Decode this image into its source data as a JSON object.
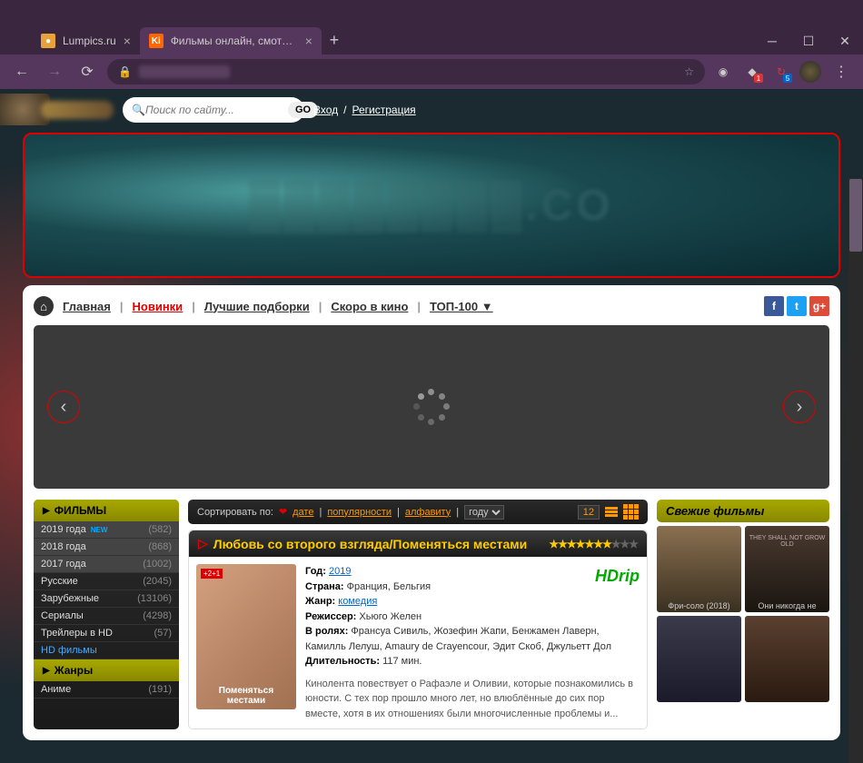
{
  "browser": {
    "tab1": "Lumpics.ru",
    "tab2": "Фильмы онлайн, смотреть бесп"
  },
  "header": {
    "search_placeholder": "Поиск по сайту...",
    "go": "GO",
    "login": "Вход",
    "register": "Регистрация"
  },
  "banner_suffix": ".CO",
  "nav": {
    "home": "Главная",
    "new": "Новинки",
    "best": "Лучшие подборки",
    "soon": "Скоро в кино",
    "top": "ТОП-100 ▼"
  },
  "sidebar": {
    "films": "ФИЛЬМЫ",
    "items": [
      {
        "label": "2019 года",
        "new": "NEW",
        "count": "(582)"
      },
      {
        "label": "2018 года",
        "count": "(868)"
      },
      {
        "label": "2017 года",
        "count": "(1002)"
      },
      {
        "label": "Русские",
        "count": "(2045)"
      },
      {
        "label": "Зарубежные",
        "count": "(13106)"
      },
      {
        "label": "Сериалы",
        "count": "(4298)"
      },
      {
        "label": "Трейлеры в HD",
        "count": "(57)"
      },
      {
        "label": "HD фильмы",
        "hd": true
      }
    ],
    "genres": "Жанры",
    "anime": {
      "label": "Аниме",
      "count": "(191)"
    }
  },
  "sort": {
    "label": "Сортировать по:",
    "date": "дате",
    "pop": "популярности",
    "alpha": "алфавиту",
    "year": "году",
    "perpage": "12"
  },
  "movie": {
    "title": "Любовь со второго взгляда/Поменяться местами",
    "year_l": "Год:",
    "year": "2019",
    "country_l": "Страна:",
    "country": "Франция, Бельгия",
    "genre_l": "Жанр:",
    "genre": "комедия",
    "director_l": "Режиссер:",
    "director": "Хьюго Желен",
    "cast_l": "В ролях:",
    "cast": "Франсуа Сивиль, Жозефин Жапи, Бенжамен Лаверн, Камилль Лелуш, Amaury de Crayencour, Эдит Скоб, Джульетт Дол",
    "duration_l": "Длительность:",
    "duration": "117 мин.",
    "desc": "Кинолента повествует о Рафаэле и Оливии, которые познакомились в юности. С тех пор прошло много лет, но влюблённые до сих пор вместе, хотя в их отношениях были многочисленные проблемы и...",
    "quality": "HDrip",
    "poster_line1": "Поменяться",
    "poster_line2": "местами",
    "age": "+2+1"
  },
  "fresh": {
    "title": "Свежие фильмы",
    "items": [
      "Фри-соло (2018)",
      "Они никогда не",
      "",
      ""
    ],
    "badge": "THEY SHALL NOT GROW OLD"
  }
}
